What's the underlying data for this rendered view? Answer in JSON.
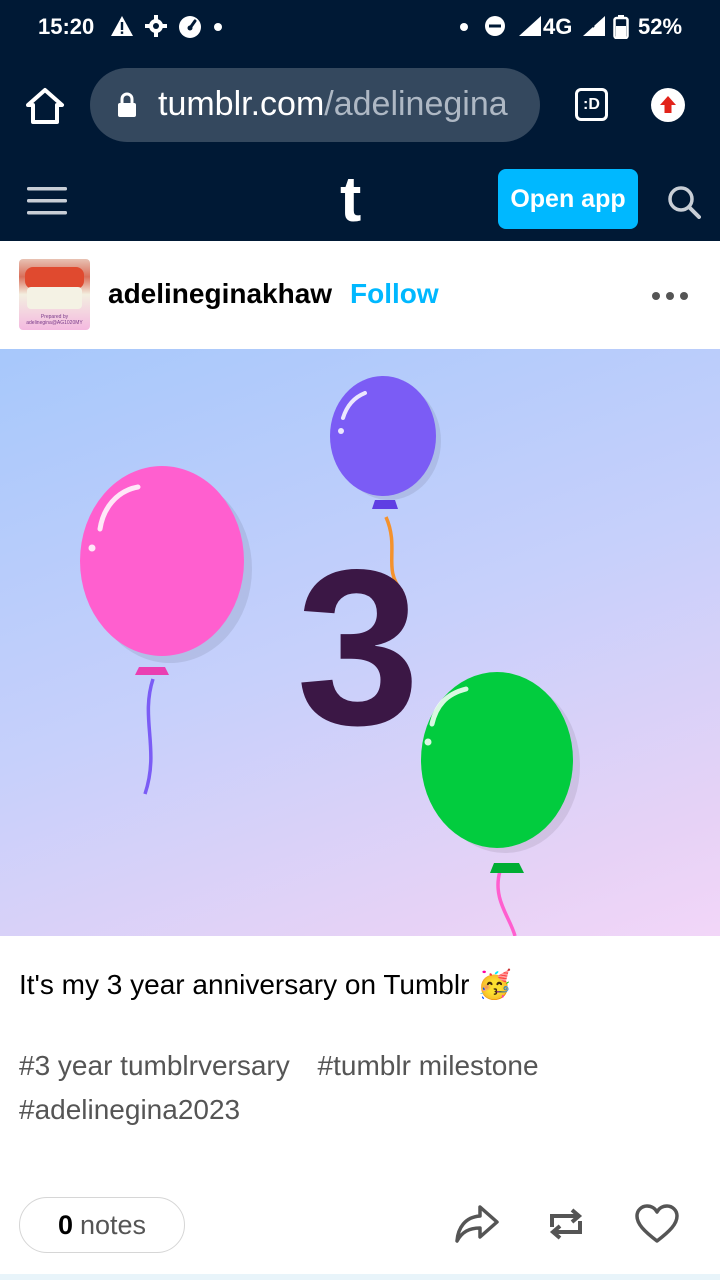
{
  "status_bar": {
    "time": "15:20",
    "network": "4G",
    "battery": "52%"
  },
  "browser": {
    "url_domain": "tumblr.com",
    "url_path": "/adelinegina",
    "tab_switcher_label": ":D"
  },
  "tumblr_header": {
    "logo": "t",
    "open_app_label": "Open app"
  },
  "post": {
    "blog_name": "adelineginakhaw",
    "follow_label": "Follow",
    "avatar_caption": "Prepared by adelinegina@AG1020MY",
    "image_number": "3",
    "caption": "It's my 3 year anniversary on Tumblr 🥳",
    "tags": [
      "#3 year tumblrversary",
      "#tumblr milestone",
      "#adelinegina2023"
    ],
    "notes_count": "0",
    "notes_label": "notes"
  },
  "colors": {
    "dark_navy": "#001935",
    "accent_blue": "#00b8ff",
    "balloon_pink": "#ff5fcf",
    "balloon_purple": "#7b5cf5",
    "balloon_green": "#02cc3e",
    "number_color": "#3b1745"
  },
  "icons": {
    "home": "home-icon",
    "lock": "lock-icon",
    "tabs": "tab-switcher-icon",
    "upload": "upload-icon",
    "menu": "menu-icon",
    "search": "search-icon",
    "more": "more-dots-icon",
    "share": "share-icon",
    "reblog": "reblog-icon",
    "like": "heart-icon"
  }
}
